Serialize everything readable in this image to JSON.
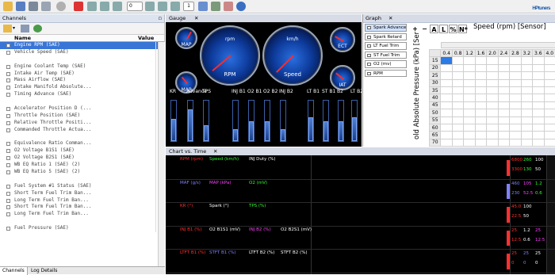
{
  "app": {
    "brand": "HPtuners",
    "brand_suffix": "®"
  },
  "toolbar": {
    "icons": [
      "open-icon",
      "save-icon",
      "device-icon",
      "print-icon",
      "record-icon",
      "stop-icon",
      "play-icon",
      "pause-icon",
      "first-icon",
      "rewind-icon",
      "step-icon",
      "loop-icon",
      "toggle-icon",
      "layout-icon",
      "chart-icon",
      "info-icon"
    ],
    "frame_label": "0",
    "counter": "1"
  },
  "channels": {
    "title": "Channels",
    "pin": "▫",
    "col_name": "Name",
    "col_value": "Value",
    "items": [
      {
        "label": "Engine RPM (SAE)",
        "selected": true
      },
      {
        "label": "Vehicle Speed (SAE)"
      },
      {
        "label": ""
      },
      {
        "label": "Engine Coolant Temp (SAE)"
      },
      {
        "label": "Intake Air Temp (SAE)"
      },
      {
        "label": "Mass Airflow (SAE)"
      },
      {
        "label": "Intake Manifold Absolute..."
      },
      {
        "label": "Timing Advance (SAE)"
      },
      {
        "label": ""
      },
      {
        "label": "Accelerator Position D (..."
      },
      {
        "label": "Throttle Position (SAE)"
      },
      {
        "label": "Relative Throttle Positi..."
      },
      {
        "label": "Commanded Throttle Actua..."
      },
      {
        "label": ""
      },
      {
        "label": "Equivalence Ratio Comman..."
      },
      {
        "label": "O2 Voltage B1S1 (SAE)"
      },
      {
        "label": "O2 Voltage B2S1 (SAE)"
      },
      {
        "label": "WB EQ Ratio 1 (SAE) (2)"
      },
      {
        "label": "WB EQ Ratio 5 (SAE) (2)"
      },
      {
        "label": ""
      },
      {
        "label": "Fuel System #1 Status (SAE)"
      },
      {
        "label": "Short Term Fuel Trim Ban..."
      },
      {
        "label": "Long Term Fuel Trim Ban..."
      },
      {
        "label": "Short Term Fuel Trim Ban..."
      },
      {
        "label": "Long Term Fuel Trim Ban..."
      },
      {
        "label": ""
      },
      {
        "label": "Fuel Pressure (SAE)"
      }
    ],
    "tabs": [
      "Channels",
      "Log Details"
    ]
  },
  "gauge": {
    "tab": "Gauge",
    "close": "✕",
    "dials": {
      "small_top_left": "MAP",
      "small_bottom_left": "MAP",
      "rpm_unit": "rpm",
      "rpm": "RPM",
      "kmh_unit": "km/h",
      "speed": "Speed",
      "ect": "ECT",
      "iat": "IAT"
    },
    "bar_labels": [
      "KR",
      "Advance",
      "TPS",
      "INJ B1",
      "O2 B1",
      "O2 B2",
      "INJ B2",
      "LT B1",
      "ST B1",
      "B2",
      "LT B2"
    ],
    "bar_levels": [
      0.55,
      0.8,
      0.4,
      0.3,
      0.5,
      0.5,
      0.3,
      0.6,
      0.5,
      0.5,
      0.6
    ]
  },
  "graph": {
    "tab": "Graph",
    "close": "✕",
    "params": [
      {
        "label": "Spark Advance",
        "color": "#ffffff",
        "selected": true
      },
      {
        "label": "Spark Retard",
        "color": "#ffffff"
      },
      {
        "label": "LT Fuel Trim",
        "color": "#ffffff"
      },
      {
        "label": "ST Fuel Trim",
        "color": "#ffffff"
      },
      {
        "label": "O2 (mv)",
        "color": "#ffffff"
      },
      {
        "label": "RPM",
        "color": "#ffffff"
      }
    ],
    "tools": [
      "+",
      "−",
      "A",
      "L",
      "%",
      "N*"
    ],
    "x_axis_label": "Speed (rpm) [Sensor]",
    "y_axis_label": "old Absolute Pressure (kPa) [Ser",
    "col_headers": [
      "0.4",
      "0.8",
      "1.2",
      "1.6",
      "2.0",
      "2.4",
      "2.8",
      "3.2",
      "3.6",
      "4.0"
    ],
    "row_headers": [
      "15",
      "20",
      "25",
      "30",
      "35",
      "40",
      "45",
      "50",
      "55",
      "60",
      "65",
      "70"
    ]
  },
  "chart": {
    "tab": "Chart vs. Time",
    "close": "✕",
    "rows": [
      {
        "labels": [
          {
            "t": "RPM (rpm)",
            "c": "#ff3030"
          },
          {
            "t": "Speed (km/h)",
            "c": "#30ff30"
          },
          {
            "t": "INJ Duty (%)",
            "c": "#ffffff"
          }
        ],
        "values": [
          {
            "t": "6800",
            "c": "#ff3030"
          },
          {
            "t": "260",
            "c": "#30ff30"
          },
          {
            "t": "100",
            "c": "#ffffff"
          },
          {
            "t": "3300",
            "c": "#ff3030"
          },
          {
            "t": "130",
            "c": "#30ff30"
          },
          {
            "t": "50",
            "c": "#ffffff"
          }
        ]
      },
      {
        "labels": [
          {
            "t": "MAF (g/s)",
            "c": "#8080ff"
          },
          {
            "t": "MAP (kPa)",
            "c": "#ff40ff"
          },
          {
            "t": "O2 (mV)",
            "c": "#30ff30"
          }
        ],
        "values": [
          {
            "t": "460",
            "c": "#8080ff"
          },
          {
            "t": "105",
            "c": "#ff40ff"
          },
          {
            "t": "1.2",
            "c": "#30ff30"
          },
          {
            "t": "230",
            "c": "#8080ff"
          },
          {
            "t": "52.5",
            "c": "#ff40ff"
          },
          {
            "t": "0.6",
            "c": "#30ff30"
          }
        ]
      },
      {
        "labels": [
          {
            "t": "KR (°)",
            "c": "#ff3030"
          },
          {
            "t": "Spark (°)",
            "c": "#ffffff"
          },
          {
            "t": "TPS (%)",
            "c": "#30ff30"
          }
        ],
        "values": [
          {
            "t": "45.0",
            "c": "#ff3030"
          },
          {
            "t": "100",
            "c": "#ffffff"
          },
          {
            "t": "22.5",
            "c": "#ff3030"
          },
          {
            "t": "50",
            "c": "#ffffff"
          }
        ]
      },
      {
        "labels": [
          {
            "t": "INJ B1 (%)",
            "c": "#ff3030"
          },
          {
            "t": "O2 B1S1 (mV)",
            "c": "#ffffff"
          },
          {
            "t": "INJ B2 (%)",
            "c": "#ff40ff"
          },
          {
            "t": "O2 B2S1 (mV)",
            "c": "#ffffff"
          }
        ],
        "values": [
          {
            "t": "25",
            "c": "#ff3030"
          },
          {
            "t": "1.2",
            "c": "#ffffff"
          },
          {
            "t": "25",
            "c": "#ff40ff"
          },
          {
            "t": "12.5",
            "c": "#ff3030"
          },
          {
            "t": "0.6",
            "c": "#ffffff"
          },
          {
            "t": "12.5",
            "c": "#ff40ff"
          }
        ]
      },
      {
        "labels": [
          {
            "t": "LTFT B1 (%)",
            "c": "#ff3030"
          },
          {
            "t": "STFT B1 (%)",
            "c": "#8080ff"
          },
          {
            "t": "LTFT B2 (%)",
            "c": "#ffffff"
          },
          {
            "t": "STFT B2 (%)",
            "c": "#ffffff"
          }
        ],
        "values": [
          {
            "t": "25",
            "c": "#ff3030"
          },
          {
            "t": "25",
            "c": "#8080ff"
          },
          {
            "t": "25",
            "c": "#ffffff"
          },
          {
            "t": "0",
            "c": "#ff3030"
          },
          {
            "t": "0",
            "c": "#8080ff"
          },
          {
            "t": "0",
            "c": "#ffffff"
          }
        ]
      }
    ]
  }
}
